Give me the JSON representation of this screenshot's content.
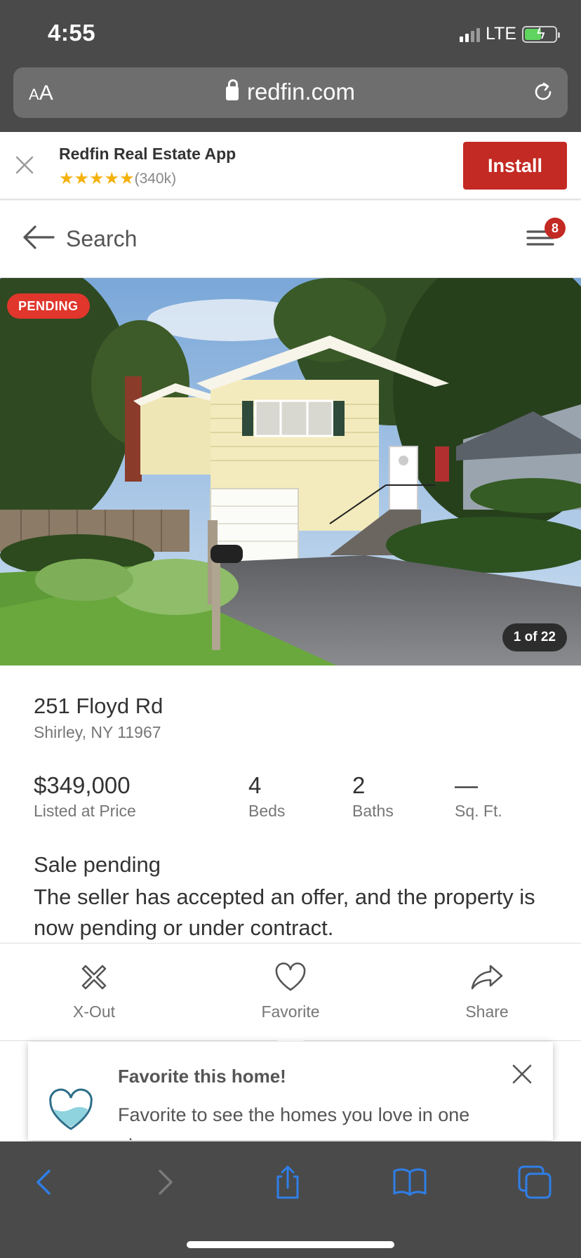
{
  "status_bar": {
    "time": "4:55",
    "network": "LTE"
  },
  "browser": {
    "aa_label_small": "A",
    "aa_label_large": "A",
    "url": "redfin.com"
  },
  "app_banner": {
    "title": "Redfin Real Estate App",
    "stars": "★★★★★",
    "rating_count": "(340k)",
    "install_label": "Install"
  },
  "nav": {
    "back_label": "Search",
    "menu_badge": "8"
  },
  "photo": {
    "status_pill": "PENDING",
    "counter": "1 of 22"
  },
  "listing": {
    "address": "251 Floyd Rd",
    "city": "Shirley, NY 11967",
    "stats": [
      {
        "value": "$349,000",
        "label": "Listed at Price"
      },
      {
        "value": "4",
        "label": "Beds"
      },
      {
        "value": "2",
        "label": "Baths"
      },
      {
        "value": "—",
        "label": "Sq. Ft."
      }
    ],
    "status_heading": "Sale pending",
    "status_description": "The seller has accepted an offer, and the property is now pending or under contract."
  },
  "actions": [
    {
      "label": "X-Out",
      "icon": "x-out-icon"
    },
    {
      "label": "Favorite",
      "icon": "heart-icon"
    },
    {
      "label": "Share",
      "icon": "share-arrow-icon"
    }
  ],
  "tooltip": {
    "title": "Favorite this home!",
    "text": "Favorite to see the homes you love in one place."
  },
  "colors": {
    "brand_red": "#c32a23",
    "pending_red": "#e0362c",
    "star": "#f5b20e",
    "chrome": "#4a4a4a",
    "safari_blue": "#2f7fe8"
  }
}
